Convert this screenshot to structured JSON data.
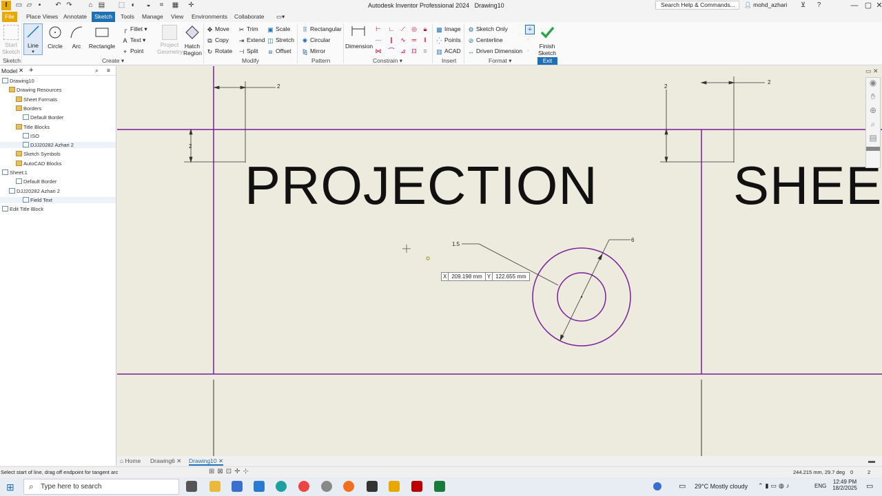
{
  "window": {
    "app_title": "Autodesk Inventor Professional 2024",
    "doc_title": "Drawing10",
    "search_placeholder": "Search Help & Commands...",
    "user": "mohd_azhari",
    "minimize": "—",
    "restore": "▢",
    "close": "✕"
  },
  "menu_tabs": [
    "File",
    "Place Views",
    "Annotate",
    "Sketch",
    "Tools",
    "Manage",
    "View",
    "Environments",
    "Collaborate"
  ],
  "ribbon": {
    "start_sketch": "Start Sketch",
    "sketch_panel": "Sketch",
    "create": {
      "line": "Line",
      "circle": "Circle",
      "arc": "Arc",
      "rectangle": "Rectangle",
      "fillet": "Fillet",
      "text": "Text",
      "point": "Point",
      "project_geometry": "Project Geometry",
      "hatch_region": "Hatch Region",
      "label": "Create"
    },
    "modify": {
      "move": "Move",
      "copy": "Copy",
      "rotate": "Rotate",
      "trim": "Trim",
      "extend": "Extend",
      "split": "Split",
      "scale": "Scale",
      "stretch": "Stretch",
      "offset": "Offset",
      "label": "Modify"
    },
    "pattern": {
      "rectangular": "Rectangular",
      "circular": "Circular",
      "mirror": "Mirror",
      "label": "Pattern"
    },
    "constrain": {
      "dimension": "Dimension",
      "label": "Constrain"
    },
    "insert": {
      "image": "Image",
      "points": "Points",
      "acad": "ACAD",
      "label": "Insert"
    },
    "format": {
      "sketch_only": "Sketch Only",
      "centerline": "Centerline",
      "driven_dimension": "Driven Dimension",
      "label": "Format"
    },
    "exit": {
      "finish_sketch": "Finish Sketch",
      "label": "Exit"
    }
  },
  "browser": {
    "tab": "Model",
    "items": [
      {
        "label": "Drawing10",
        "indent": 0,
        "icon": "sheet"
      },
      {
        "label": "Drawing Resources",
        "indent": 1,
        "icon": "folder"
      },
      {
        "label": "Sheet Formats",
        "indent": 2,
        "icon": "folder"
      },
      {
        "label": "Borders",
        "indent": 2,
        "icon": "folder"
      },
      {
        "label": "Default Border",
        "indent": 3,
        "icon": "sheet"
      },
      {
        "label": "Title Blocks",
        "indent": 2,
        "icon": "folder"
      },
      {
        "label": "ISO",
        "indent": 3,
        "icon": "sheet"
      },
      {
        "label": "DJJ20282 Azhari 2",
        "indent": 3,
        "icon": "sheet"
      },
      {
        "label": "Sketch Symbols",
        "indent": 2,
        "icon": "folder"
      },
      {
        "label": "AutoCAD Blocks",
        "indent": 2,
        "icon": "folder"
      },
      {
        "label": "Sheet:1",
        "indent": 0,
        "icon": "sheet"
      },
      {
        "label": "Default Border",
        "indent": 2,
        "icon": "sheet"
      },
      {
        "label": "DJJ20282 Azhari 2",
        "indent": 1,
        "icon": "sheet"
      },
      {
        "label": "Field Text",
        "indent": 3,
        "icon": "sheet"
      },
      {
        "label": "Edit Title Block",
        "indent": 0,
        "icon": "sheet"
      }
    ]
  },
  "canvas": {
    "title_left": "PROJECTION",
    "title_right": "SHEET",
    "dims": {
      "top_left": "2",
      "vert_left": "2",
      "top_right_h": "2",
      "top_right_v": "2",
      "leader_a": "1.5",
      "leader_b": "6"
    },
    "coord_x_label": "X",
    "coord_x": "209.198 mm",
    "coord_y_label": "Y",
    "coord_y": "122.655 mm"
  },
  "doc_tabs": [
    "Home",
    "Drawing6",
    "Drawing10"
  ],
  "status": {
    "message": "Select start of line, drag off endpoint for tangent arc",
    "readout": "244.215 mm, 29.7 deg",
    "count_a": "0",
    "count_b": "2"
  },
  "taskbar": {
    "search": "Type here to search",
    "weather": "29°C  Mostly cloudy",
    "lang": "ENG",
    "time": "12:49 PM",
    "date": "18/2/2025"
  },
  "colors": {
    "accent": "#1e6fb4",
    "file_tab": "#e8a800",
    "sheet": "#ecebdd",
    "border_line": "#7a1e9e"
  }
}
